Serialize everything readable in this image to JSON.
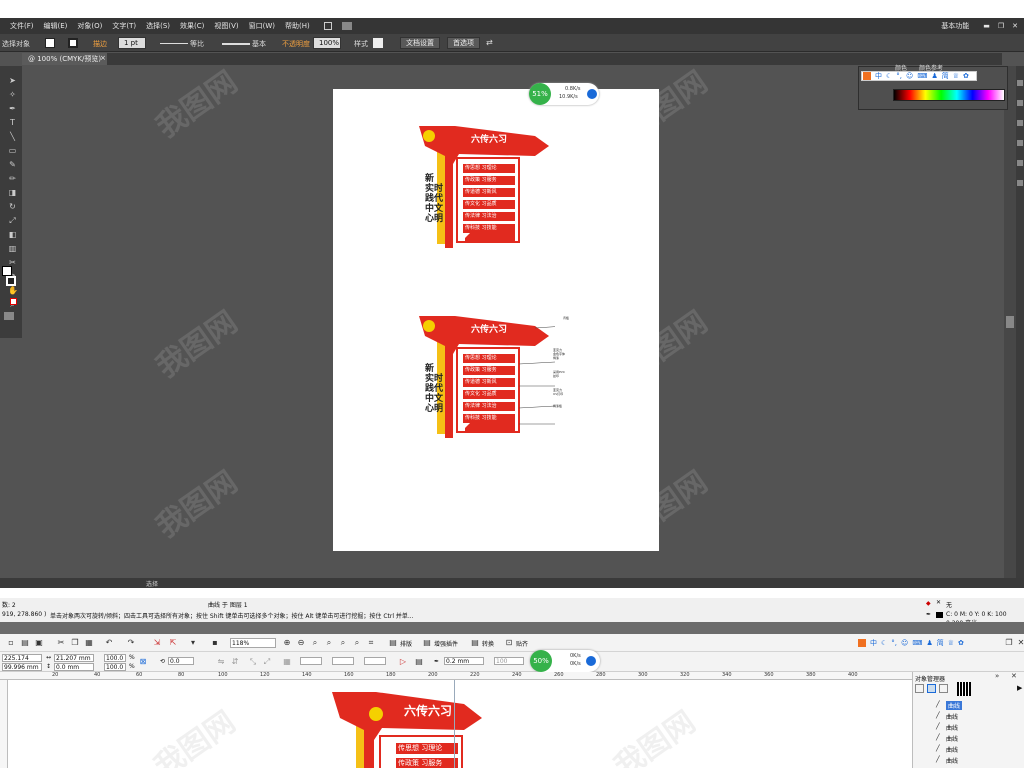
{
  "illustrator": {
    "menu": [
      "文件(F)",
      "编辑(E)",
      "对象(O)",
      "文字(T)",
      "选择(S)",
      "效果(C)",
      "视图(V)",
      "窗口(W)",
      "帮助(H)"
    ],
    "workspace": "基本功能",
    "control": {
      "selection_label": "选择对象",
      "stroke_label": "描边",
      "stroke_weight": "1 pt",
      "profile": "等比",
      "brush": "基本",
      "opacity_label": "不透明度",
      "opacity": "100%",
      "style_label": "样式",
      "doc_setup": "文档设置",
      "preferences": "首选项"
    },
    "tab": "@ 100% (CMYK/预览)",
    "panel_tab1": "颜色",
    "panel_tab2": "颜色参考",
    "net_meter": {
      "percent": "51%",
      "up": "0.8K/s",
      "down": "10.9K/s"
    },
    "status_fill": "选择"
  },
  "art": {
    "banner": "六传六习",
    "items": [
      "传思想 习理论",
      "传政策 习服务",
      "传道德 习新风",
      "传文化 习品质",
      "传法律 习法治",
      "传科技 习技能"
    ],
    "left_text": [
      "新",
      "实",
      "时",
      "践",
      "代",
      "中",
      "文",
      "心",
      "明"
    ],
    "annotations": [
      "背板",
      "亚克力",
      "金色字体",
      "烤漆",
      "采用PVC",
      "丝印",
      "亚克力",
      "UV打印",
      "烤漆板"
    ]
  },
  "coreldraw": {
    "object_count": "数: 2",
    "cursor_pos": "919, 278.860 )",
    "layer_info": "曲线 于 图层 1",
    "hint": "单击对象两次可旋转/倾斜；四击工具可选择所有对象；按住 Shift 键单击可选择多个对象；按住 Alt 键单击可进行挖掘；按住 Ctrl 并单...",
    "fill_none": "无",
    "outline_info": "C: 0 M: 0 Y: 0 K: 100  0.200 毫米",
    "zoom": "118%",
    "toolbar_labels": [
      "排版",
      "增强插件",
      "转换",
      "贴齐"
    ],
    "x": "225.174 mm",
    "y": "99.996 mm",
    "w": "21.207 mm",
    "h": "0.0 mm",
    "scale_x": "100.0",
    "scale_y": "100.0",
    "pct": "%",
    "rotate": "0.0",
    "outline_width": "0.2 mm",
    "node_val": "100",
    "net_meter": {
      "percent": "50%",
      "up": "0K/s",
      "down": "0K/s"
    },
    "ruler_ticks": [
      "20",
      "40",
      "60",
      "80",
      "100",
      "120",
      "140",
      "160",
      "180",
      "200",
      "220",
      "240",
      "260",
      "280",
      "300",
      "320",
      "340",
      "360",
      "380",
      "400"
    ],
    "objmgr_title": "对象管理器",
    "objects": [
      "曲线",
      "曲线",
      "曲线",
      "曲线",
      "曲线",
      "曲线",
      "曲线"
    ],
    "banner": "六传六习",
    "item1": "传思想 习理论",
    "item2": "传政策 习服务"
  },
  "colors": {
    "ai_bg": "#535353",
    "red": "#e12a1f",
    "gold": "#f5c016",
    "corel_bg": "#ffffff"
  }
}
